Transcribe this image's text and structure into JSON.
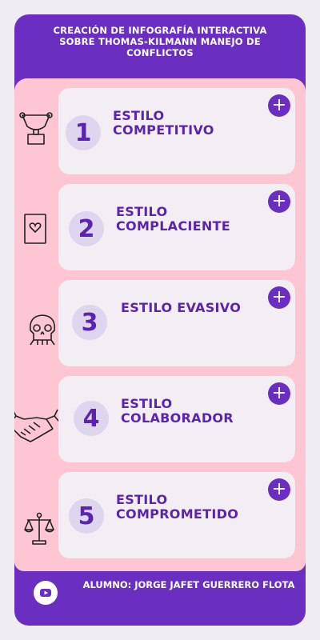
{
  "header": {
    "title": "CREACIÓN DE INFOGRAFÍA INTERACTIVA SOBRE THOMAS-KILMANN MANEJO DE CONFLICTOS"
  },
  "items": [
    {
      "number": "1",
      "label": "ESTILO COMPETITIVO",
      "icon": "trophy-icon"
    },
    {
      "number": "2",
      "label": "ESTILO COMPLACIENTE",
      "icon": "heart-card-icon"
    },
    {
      "number": "3",
      "label": "ESTILO EVASIVO",
      "icon": "skull-icon"
    },
    {
      "number": "4",
      "label": "ESTILO COLABORADOR",
      "icon": "handshake-icon"
    },
    {
      "number": "5",
      "label": "ESTILO COMPROMETIDO",
      "icon": "scales-icon"
    }
  ],
  "expand_symbol": "+",
  "footer": {
    "author": "ALUMNO: JORGE JAFET GUERRERO FLOTA",
    "video_icon": "youtube-icon"
  },
  "colors": {
    "background": "#efecf2",
    "primary_purple": "#6a2fc0",
    "panel_pink": "#fdc6d2",
    "item_box": "#f2eef4",
    "number_circle": "#ddd6ee",
    "text_purple": "#5a24b0"
  }
}
